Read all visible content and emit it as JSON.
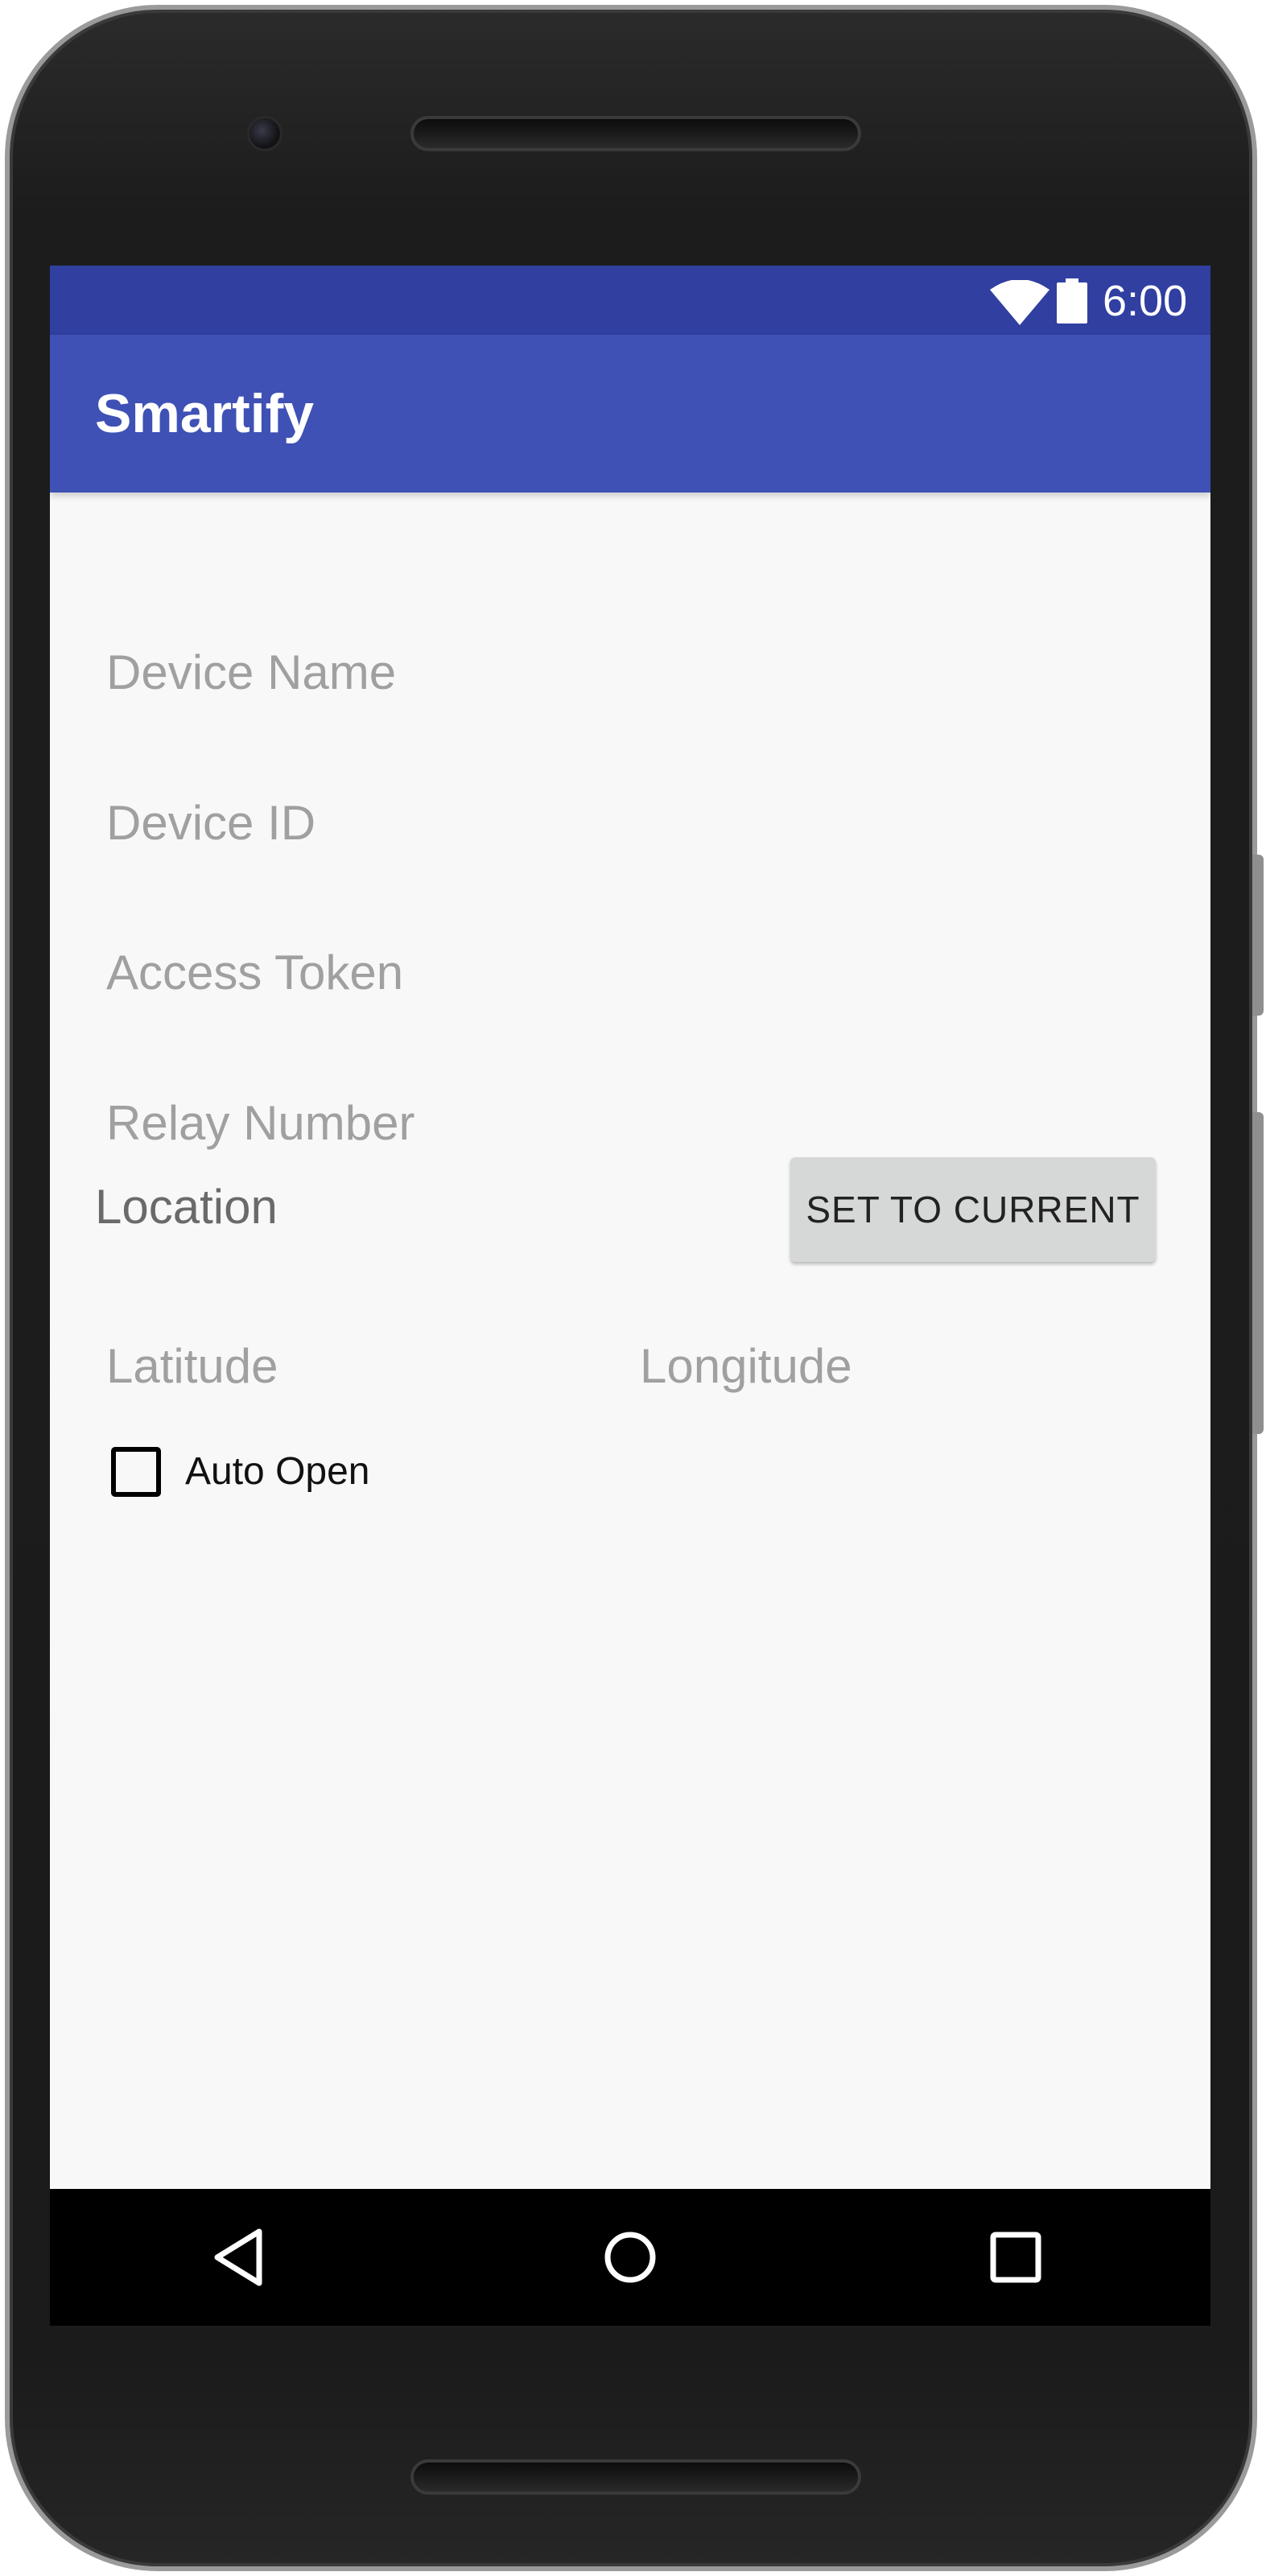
{
  "status_bar": {
    "time": "6:00",
    "icons": [
      "wifi-icon",
      "battery-icon"
    ]
  },
  "app_bar": {
    "title": "Smartify"
  },
  "form": {
    "device_name_placeholder": "Device Name",
    "device_id_placeholder": "Device ID",
    "access_token_placeholder": "Access Token",
    "relay_number_placeholder": "Relay Number",
    "device_name_value": "",
    "device_id_value": "",
    "access_token_value": "",
    "relay_number_value": ""
  },
  "location": {
    "label": "Location",
    "set_button_label": "SET TO CURRENT",
    "latitude_placeholder": "Latitude",
    "longitude_placeholder": "Longitude",
    "latitude_value": "",
    "longitude_value": ""
  },
  "auto_open": {
    "label": "Auto Open",
    "checked": false
  },
  "nav_bar": {
    "buttons": [
      "back-icon",
      "home-icon",
      "recents-icon"
    ]
  },
  "colors": {
    "status_bar": "#303fa0",
    "app_bar": "#3f51b5",
    "background": "#f8f8f8",
    "button": "#d6d7d7",
    "placeholder": "#a0a0a0"
  }
}
